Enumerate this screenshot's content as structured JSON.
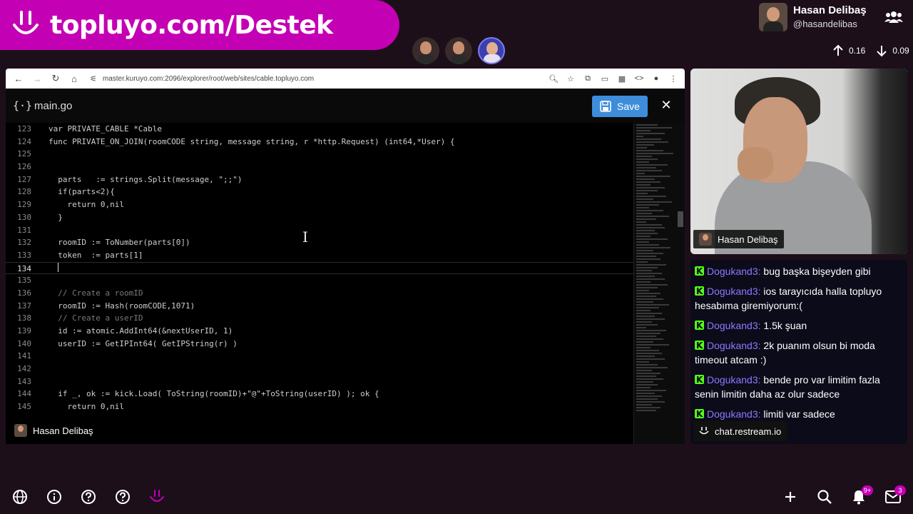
{
  "banner": {
    "text": "topluyo.com/Destek"
  },
  "profile": {
    "name": "Hasan Delibaş",
    "handle": "@hasandelibas"
  },
  "stats": {
    "up": "0.16",
    "down": "0.09"
  },
  "browser": {
    "url": "master.kuruyo.com:2096/explorer/root/web/sites/cable.topluyo.com"
  },
  "editor": {
    "filename": "main.go",
    "save_label": "Save",
    "lines": [
      {
        "n": "123",
        "t": "var PRIVATE_CABLE *Cable"
      },
      {
        "n": "124",
        "t": "func PRIVATE_ON_JOIN(roomCODE string, message string, r *http.Request) (int64,*User) {"
      },
      {
        "n": "125",
        "t": ""
      },
      {
        "n": "126",
        "t": ""
      },
      {
        "n": "127",
        "t": "  parts   := strings.Split(message, \";;\")"
      },
      {
        "n": "128",
        "t": "  if(parts<2){"
      },
      {
        "n": "129",
        "t": "    return 0,nil"
      },
      {
        "n": "130",
        "t": "  }"
      },
      {
        "n": "131",
        "t": ""
      },
      {
        "n": "132",
        "t": "  roomID := ToNumber(parts[0])"
      },
      {
        "n": "133",
        "t": "  token  := parts[1]"
      },
      {
        "n": "134",
        "t": "  "
      },
      {
        "n": "135",
        "t": ""
      },
      {
        "n": "136",
        "t": "  // Create a roomID"
      },
      {
        "n": "137",
        "t": "  roomID := Hash(roomCODE,1071)"
      },
      {
        "n": "138",
        "t": "  // Create a userID"
      },
      {
        "n": "139",
        "t": "  id := atomic.AddInt64(&nextUserID, 1)"
      },
      {
        "n": "140",
        "t": "  userID := GetIPInt64( GetIPString(r) )"
      },
      {
        "n": "141",
        "t": ""
      },
      {
        "n": "142",
        "t": ""
      },
      {
        "n": "143",
        "t": ""
      },
      {
        "n": "144",
        "t": "  if _, ok := kick.Load( ToString(roomID)+\"@\"+ToString(userID) ); ok {"
      },
      {
        "n": "145",
        "t": "    return 0,nil"
      }
    ]
  },
  "screen_label": "Hasan Delibaş",
  "webcam_label": "Hasan Delibaş",
  "chat": {
    "messages": [
      {
        "user": "Dogukand3:",
        "text": "bug başka bişeyden gibi"
      },
      {
        "user": "Dogukand3:",
        "text": "ios tarayıcıda halla topluyo hesabıma giremiyorum:("
      },
      {
        "user": "Dogukand3:",
        "text": "1.5k şuan"
      },
      {
        "user": "Dogukand3:",
        "text": "2k puanım olsun bi moda timeout atcam :)"
      },
      {
        "user": "Dogukand3:",
        "text": "bende pro var limitim fazla senin limitin daha az olur sadece"
      },
      {
        "user": "Dogukand3:",
        "text": "limiti var sadece"
      }
    ],
    "footer": "chat.restream.io"
  },
  "bottom": {
    "notif_badge": "9+",
    "mail_badge": "3"
  },
  "colors": {
    "brand": "#c400b4",
    "save": "#3d8ddb",
    "chat_user": "#8b7bff",
    "kick": "#53fc18"
  }
}
